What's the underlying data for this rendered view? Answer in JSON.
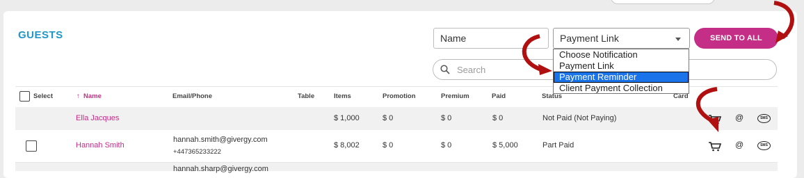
{
  "title": "GUESTS",
  "filters": {
    "name_value": "Name",
    "notification_selected": "Payment Link",
    "notification_options": [
      "Choose Notification",
      "Payment Link",
      "Payment Reminder",
      "Client Payment Collection"
    ],
    "highlighted_option": "Payment Reminder",
    "send_label": "SEND TO ALL",
    "search_placeholder": "Search"
  },
  "table": {
    "columns": {
      "select": "Select",
      "name": "Name",
      "email": "Email/Phone",
      "table": "Table",
      "items": "Items",
      "promotion": "Promotion",
      "premium": "Premium",
      "paid": "Paid",
      "status": "Status",
      "card": "Card"
    },
    "sort_indicator": "↑",
    "rows": [
      {
        "name": "Ella Jacques",
        "email": "",
        "phone": "",
        "items": "$ 1,000",
        "promotion": "$ 0",
        "premium": "$ 0",
        "paid": "$ 0",
        "status": "Not Paid (Not Paying)"
      },
      {
        "name": "Hannah Smith",
        "email": "hannah.smith@givergy.com",
        "phone": "+447365233222",
        "items": "$ 8,002",
        "promotion": "$ 0",
        "premium": "$ 0",
        "paid": "$ 5,000",
        "status": "Part Paid"
      },
      {
        "name": "",
        "email": "hannah.sharp@givergy.com",
        "phone": "",
        "items": "",
        "promotion": "",
        "premium": "",
        "paid": "",
        "status": ""
      }
    ]
  },
  "icons": {
    "cart": "cart-icon",
    "email": "@",
    "sms": "SMS"
  },
  "colors": {
    "accent_blue": "#2196c9",
    "brand_pink": "#c42e86",
    "annotation_red": "#b01010"
  }
}
